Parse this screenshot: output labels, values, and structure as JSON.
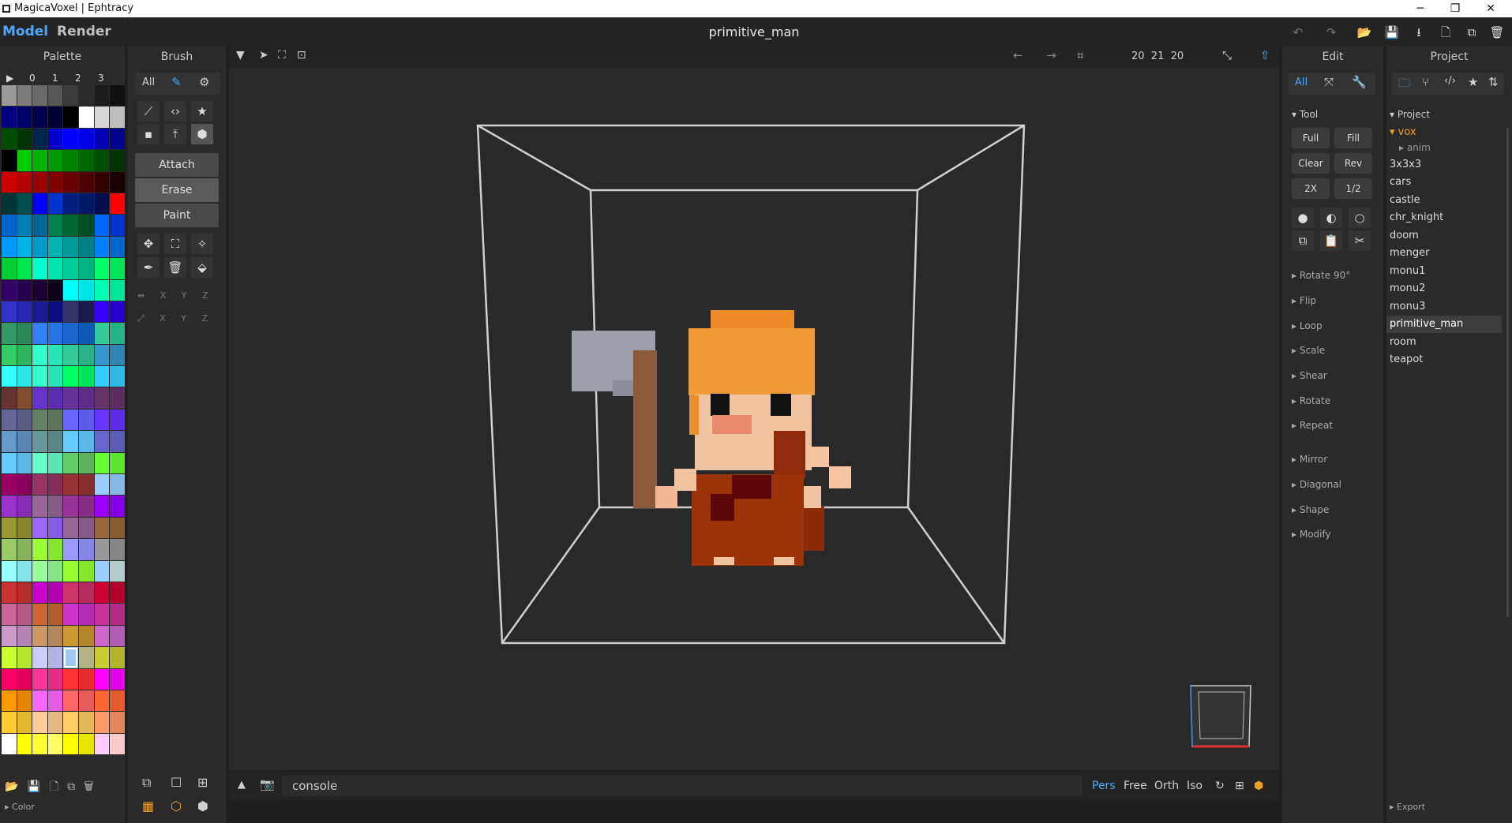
{
  "window": {
    "title": "MagicaVoxel | Ephtracy",
    "min": "─",
    "max": "❐",
    "close": "✕"
  },
  "menu": {
    "model": "Model",
    "render": "Render",
    "doc": "primitive_man"
  },
  "topbar": {
    "undo": "↶",
    "redo": "↷",
    "open": "📂",
    "save": "💾",
    "export": "⭳",
    "new": "🗋",
    "copy": "⧉",
    "delete": "🗑",
    "nav_left": "←",
    "nav_right": "→",
    "crop": "⌗",
    "size": "20  21  20",
    "fit": "⤡",
    "up": "⇧"
  },
  "palette": {
    "title": "Palette",
    "cols": [
      "▶",
      "0",
      "1",
      "2",
      "3"
    ],
    "footer": "▸ Color",
    "colors": [
      "#9a9a9a",
      "#7d7d7d",
      "#6a6a6a",
      "#565656",
      "#3c3c3c",
      "#2a2a2a",
      "#1c1c1c",
      "#101010",
      "#000080",
      "#000066",
      "#00004d",
      "#000033",
      "#000000",
      "#ffffff",
      "#d8d8d8",
      "#bdbdbd",
      "#004d00",
      "#003300",
      "#00264d",
      "#0000cc",
      "#0000ff",
      "#0000e6",
      "#0000b3",
      "#00008c",
      "#000000",
      "#00cc00",
      "#00b300",
      "#009900",
      "#008000",
      "#006600",
      "#004d00",
      "#003300",
      "#cc0000",
      "#b30000",
      "#990000",
      "#800000",
      "#660000",
      "#4d0000",
      "#330000",
      "#1a0000",
      "#003333",
      "#004d4d",
      "#0000ff",
      "#0033cc",
      "#002080",
      "#001a66",
      "#000d4d",
      "#ff0000",
      "#0066cc",
      "#0080b3",
      "#006699",
      "#00804d",
      "#006633",
      "#004d26",
      "#0066ff",
      "#0033cc",
      "#0099ff",
      "#00b3e6",
      "#0099cc",
      "#00b3b3",
      "#009999",
      "#008080",
      "#0080ff",
      "#0066cc",
      "#00cc33",
      "#00e64d",
      "#00ffcc",
      "#00e6b3",
      "#00cc99",
      "#00b380",
      "#00ff66",
      "#00e65c",
      "#330066",
      "#26004d",
      "#1a0033",
      "#0d001a",
      "#00ffff",
      "#00e6e6",
      "#00ffb3",
      "#00e699",
      "#3333cc",
      "#2626b3",
      "#1a1a99",
      "#0d0d80",
      "#333366",
      "#1a1a4d",
      "#3300ff",
      "#2600cc",
      "#339966",
      "#2d8659",
      "#3380ff",
      "#2673e6",
      "#1a66cc",
      "#0d59b3",
      "#33cc99",
      "#26b386",
      "#33cc66",
      "#2db35c",
      "#33ffcc",
      "#29e6b8",
      "#33cc99",
      "#29b386",
      "#3399cc",
      "#2d86b3",
      "#33ffff",
      "#2de6e6",
      "#33ffcc",
      "#29e6b8",
      "#00ff66",
      "#00e65c",
      "#33ccff",
      "#2db8e6",
      "#663333",
      "#804d33",
      "#6633cc",
      "#5c2db3",
      "#663399",
      "#5c2d86",
      "#663366",
      "#5c2d5c",
      "#666699",
      "#5c5c86",
      "#668066",
      "#5c735c",
      "#6666ff",
      "#5c5ce6",
      "#6633ff",
      "#5c2de6",
      "#6699cc",
      "#5c86b3",
      "#669999",
      "#5c8686",
      "#66ccff",
      "#5cb8e6",
      "#6666cc",
      "#5c5cb3",
      "#66ccff",
      "#5cb8e6",
      "#66ffcc",
      "#5ce6b8",
      "#66cc66",
      "#5cb35c",
      "#66ff33",
      "#5ce62d",
      "#990066",
      "#86005c",
      "#993366",
      "#862d5c",
      "#993333",
      "#862d2d",
      "#99ccff",
      "#86b8e6",
      "#9933cc",
      "#862db3",
      "#996699",
      "#865c86",
      "#993399",
      "#862d86",
      "#9900ff",
      "#8600e6",
      "#999933",
      "#86862d",
      "#9966ff",
      "#865ce6",
      "#996699",
      "#865c86",
      "#99663d",
      "#865c33",
      "#99cc66",
      "#86b35c",
      "#99ff33",
      "#86e62d",
      "#9999ff",
      "#8686e6",
      "#999999",
      "#868686",
      "#99ffff",
      "#86e6e6",
      "#99ff99",
      "#86e686",
      "#99ff33",
      "#86e62d",
      "#99ccff",
      "#b3cccc",
      "#cc3333",
      "#b32d2d",
      "#cc00cc",
      "#b300b3",
      "#cc3366",
      "#b32d5c",
      "#cc0033",
      "#b3002d",
      "#cc6699",
      "#b35c86",
      "#cc6633",
      "#b35c2d",
      "#cc33cc",
      "#b32db3",
      "#cc3399",
      "#b32d86",
      "#cc99cc",
      "#b386b3",
      "#cc9966",
      "#b3865c",
      "#cc9933",
      "#b3862d",
      "#cc66cc",
      "#b35cb3",
      "#ccff33",
      "#b3e62d",
      "#ccccff",
      "#b3b3e6",
      "#cccc99",
      "#b3b386",
      "#cccc33",
      "#b3b32d",
      "#ff0066",
      "#e6005c",
      "#ff3399",
      "#e62d86",
      "#ff3333",
      "#e62d2d",
      "#ff00ff",
      "#e600e6",
      "#ff9900",
      "#e68600",
      "#ff66ff",
      "#e65ce6",
      "#ff6666",
      "#e65c5c",
      "#ff6633",
      "#e65c2d",
      "#ffcc33",
      "#e6b82d",
      "#ffcc99",
      "#e6b886",
      "#ffcc66",
      "#e6b85c",
      "#ff9966",
      "#e6865c",
      "#ffffff",
      "#ffff00",
      "#ffff33",
      "#ffff66",
      "#ffff00",
      "#e6e600",
      "#ffccff",
      "#ffcccc"
    ]
  },
  "brush": {
    "title": "Brush",
    "all": "All",
    "attach": "Attach",
    "erase": "Erase",
    "paint": "Paint",
    "axes": [
      "X",
      "Y",
      "Z"
    ]
  },
  "edit": {
    "title": "Edit",
    "all": "All",
    "tool": "▾ Tool",
    "full": "Full",
    "fill": "Fill",
    "clear": "Clear",
    "rev": "Rev",
    "x2": "2X",
    "half": "1/2",
    "sections": [
      "▸ Rotate 90°",
      "▸ Flip",
      "▸ Loop",
      "▸ Scale",
      "▸ Shear",
      "▸ Rotate",
      "▸ Repeat",
      "▸ Mirror",
      "▸ Diagonal",
      "▸ Shape",
      "▸ Modify"
    ]
  },
  "project": {
    "title": "Project",
    "header": "▾ Project",
    "vox": "▾ vox",
    "anim": "▸ anim",
    "items": [
      "3x3x3",
      "cars",
      "castle",
      "chr_knight",
      "doom",
      "menger",
      "monu1",
      "monu2",
      "monu3",
      "primitive_man",
      "room",
      "teapot"
    ],
    "export": "▸ Export"
  },
  "bottom": {
    "console": "console",
    "pers": "Pers",
    "free": "Free",
    "orth": "Orth",
    "iso": "Iso"
  },
  "colors": {
    "accent": "#4aa8ff",
    "selected_item": "#3e3e3e"
  }
}
